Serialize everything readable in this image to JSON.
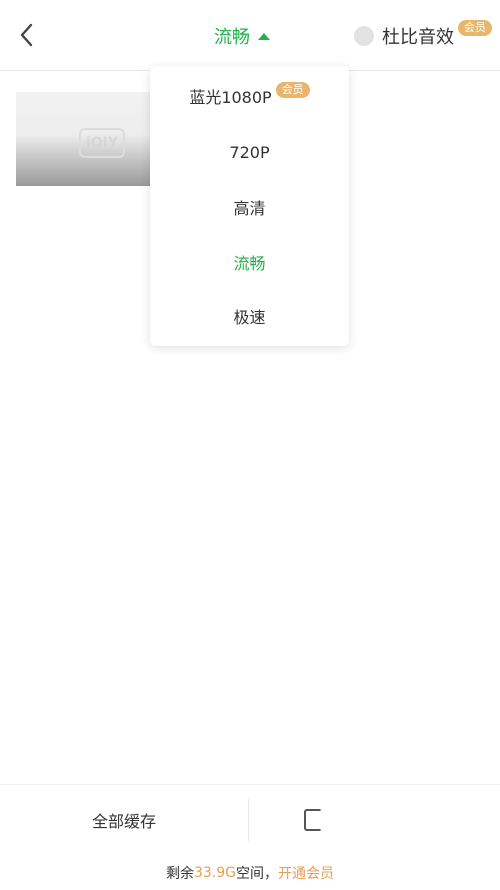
{
  "header": {
    "quality_selected": "流畅",
    "dolby_label": "杜比音效",
    "dolby_badge": "会员"
  },
  "dropdown": {
    "options": [
      {
        "label": "蓝光1080P",
        "badge": "会员"
      },
      {
        "label": "720P"
      },
      {
        "label": "高清"
      },
      {
        "label": "流畅",
        "active": true
      },
      {
        "label": "极速"
      }
    ]
  },
  "thumbnail": {
    "logo_text": "iQIY"
  },
  "footer": {
    "cache_all_label": "全部缓存"
  },
  "storage": {
    "prefix": "剩余",
    "amount": "33.9G",
    "suffix": "空间，",
    "vip_text": "开通会员"
  },
  "colors": {
    "accent": "#22b14c",
    "vip": "#e8b56a"
  }
}
